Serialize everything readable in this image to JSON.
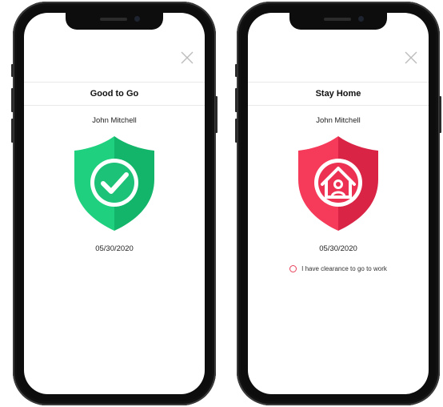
{
  "phones": [
    {
      "status_title": "Good to Go",
      "name": "John Mitchell",
      "date": "05/30/2020",
      "shield_icon": "check-icon",
      "colors": {
        "shield_light": "#1fd07e",
        "shield_dark": "#12b56a"
      }
    },
    {
      "status_title": "Stay Home",
      "name": "John Mitchell",
      "date": "05/30/2020",
      "shield_icon": "home-person-icon",
      "colors": {
        "shield_light": "#f53a5a",
        "shield_dark": "#d92446"
      },
      "clearance": {
        "label": "I have clearance to go to work",
        "checked": false
      }
    }
  ],
  "close_icon": "close-icon"
}
